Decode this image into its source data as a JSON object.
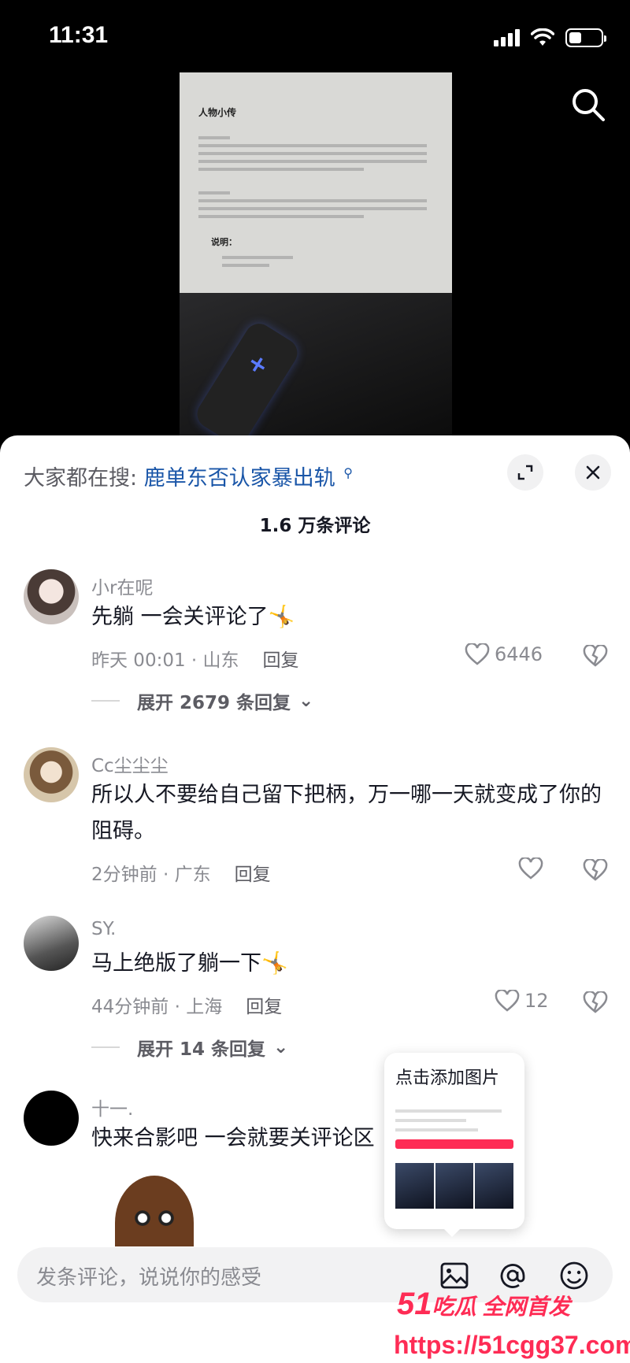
{
  "status_bar": {
    "time": "11:31"
  },
  "video": {
    "doc_title": "人物小传",
    "doc_subtitle": "说明：",
    "accent": "#5b7bff"
  },
  "sheet": {
    "hot_search_label": "大家都在搜:",
    "hot_search_keyword": "鹿单东否认家暴出轨",
    "comment_count": "1.6 万条评论"
  },
  "comments": [
    {
      "username": "小r在呢",
      "text": "先躺 一会关评论了🤸",
      "time_location": "昨天 00:01 · 山东",
      "reply_label": "回复",
      "likes": "6446",
      "expand_label": "展开 2679 条回复"
    },
    {
      "username": "Cc尘尘尘",
      "text": "所以人不要给自己留下把柄，万一哪一天就变成了你的阻碍。",
      "time_location": "2分钟前 · 广东",
      "reply_label": "回复",
      "likes": ""
    },
    {
      "username": "SY.",
      "text": "马上绝版了躺一下🤸",
      "time_location": "44分钟前 · 上海",
      "reply_label": "回复",
      "likes": "12",
      "expand_label": "展开 14 条回复"
    },
    {
      "username": "十一.",
      "text": "快来合影吧  一会就要关评论区"
    }
  ],
  "popup": {
    "title": "点击添加图片"
  },
  "input": {
    "placeholder": "发条评论，说说你的感受"
  },
  "watermark": {
    "logo_num": "51",
    "logo_text": "吃瓜 全网首发",
    "url": "https://51cgg37.com"
  },
  "colors": {
    "link": "#1a56a8",
    "brand": "#fe2c55",
    "muted": "#8a8b91"
  }
}
